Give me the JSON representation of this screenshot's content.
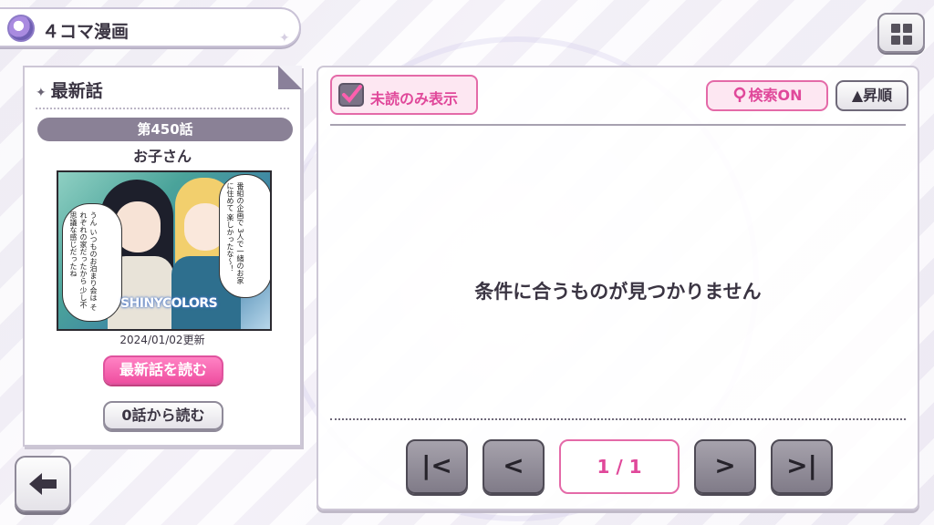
{
  "header": {
    "title": "４コマ漫画"
  },
  "latest": {
    "heading": "最新話",
    "episode_number": "第450話",
    "episode_title": "お子さん",
    "thumbnail": {
      "bubble_left": "うん いつものお泊まり会は それぞれの家だったから 少し不思議な感じだったね",
      "bubble_right": "番組の企画で 3人で一緒のお家に住めて 楽しかったな～！",
      "logo": "SHINYCOLORS"
    },
    "updated": "2024/01/02更新",
    "read_latest_label": "最新話を読む",
    "read_from_zero_label": "0話から読む"
  },
  "filters": {
    "unread_only_label": "未読のみ表示",
    "unread_only_checked": true,
    "search_label": "検索ON",
    "sort_label": "昇順"
  },
  "main": {
    "empty_message": "条件に合うものが見つかりません"
  },
  "pagination": {
    "current": "1 / 1"
  },
  "colors": {
    "accent_pink": "#e0489a",
    "panel_gray": "#8a8196"
  },
  "icons": [
    "menu-icon",
    "grid-icon",
    "back-arrow-icon",
    "checkbox-icon",
    "search-icon",
    "first-page-icon",
    "prev-page-icon",
    "next-page-icon",
    "last-page-icon"
  ]
}
